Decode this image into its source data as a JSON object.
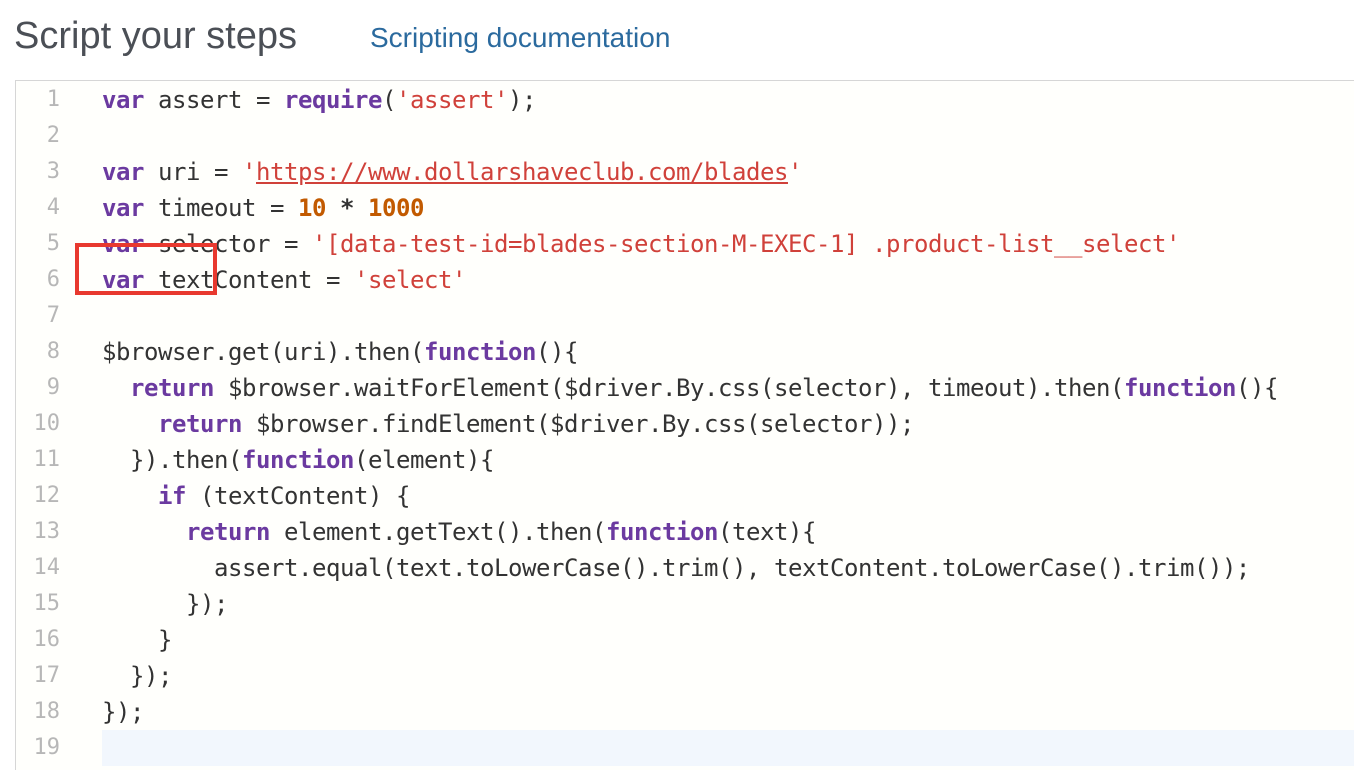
{
  "header": {
    "title": "Script your steps",
    "doc_link": "Scripting documentation"
  },
  "colors": {
    "keyword": "#6b3aa0",
    "string": "#d0413a",
    "number": "#c25a00",
    "link": "#2b6a9e",
    "highlight_box": "#e8392f",
    "gutter_text": "#b7b7b7"
  },
  "editor": {
    "line_numbers": [
      "1",
      "2",
      "3",
      "4",
      "5",
      "6",
      "7",
      "8",
      "9",
      "10",
      "11",
      "12",
      "13",
      "14",
      "15",
      "16",
      "17",
      "18",
      "19"
    ],
    "lines": [
      [
        {
          "t": "kw",
          "v": "var"
        },
        {
          "t": "p",
          "v": " assert = "
        },
        {
          "t": "kw",
          "v": "require"
        },
        {
          "t": "p",
          "v": "("
        },
        {
          "t": "str",
          "v": "'assert'"
        },
        {
          "t": "p",
          "v": ");"
        }
      ],
      [],
      [
        {
          "t": "kw",
          "v": "var"
        },
        {
          "t": "p",
          "v": " uri = "
        },
        {
          "t": "str",
          "v": "'"
        },
        {
          "t": "url",
          "v": "https://www.dollarshaveclub.com/blades"
        },
        {
          "t": "str",
          "v": "'"
        }
      ],
      [
        {
          "t": "kw",
          "v": "var"
        },
        {
          "t": "p",
          "v": " timeout = "
        },
        {
          "t": "num",
          "v": "10"
        },
        {
          "t": "p",
          "v": " "
        },
        {
          "t": "op",
          "v": "*"
        },
        {
          "t": "p",
          "v": " "
        },
        {
          "t": "num",
          "v": "1000"
        }
      ],
      [
        {
          "t": "kw",
          "v": "var"
        },
        {
          "t": "p",
          "v": " selector = "
        },
        {
          "t": "str",
          "v": "'[data-test-id=blades-section-M-EXEC-1] .product-list__select'"
        }
      ],
      [
        {
          "t": "kw",
          "v": "var"
        },
        {
          "t": "p",
          "v": " textContent = "
        },
        {
          "t": "str",
          "v": "'select'"
        }
      ],
      [],
      [
        {
          "t": "p",
          "v": "$browser.get(uri).then("
        },
        {
          "t": "kw",
          "v": "function"
        },
        {
          "t": "p",
          "v": "(){"
        }
      ],
      [
        {
          "t": "p",
          "v": "  "
        },
        {
          "t": "kw",
          "v": "return"
        },
        {
          "t": "p",
          "v": " $browser.waitForElement($driver.By.css(selector), timeout).then("
        },
        {
          "t": "kw",
          "v": "function"
        },
        {
          "t": "p",
          "v": "(){"
        }
      ],
      [
        {
          "t": "p",
          "v": "    "
        },
        {
          "t": "kw",
          "v": "return"
        },
        {
          "t": "p",
          "v": " $browser.findElement($driver.By.css(selector));"
        }
      ],
      [
        {
          "t": "p",
          "v": "  }).then("
        },
        {
          "t": "kw",
          "v": "function"
        },
        {
          "t": "p",
          "v": "(element){"
        }
      ],
      [
        {
          "t": "p",
          "v": "    "
        },
        {
          "t": "kw",
          "v": "if"
        },
        {
          "t": "p",
          "v": " (textContent) {"
        }
      ],
      [
        {
          "t": "p",
          "v": "      "
        },
        {
          "t": "kw",
          "v": "return"
        },
        {
          "t": "p",
          "v": " element.getText().then("
        },
        {
          "t": "kw",
          "v": "function"
        },
        {
          "t": "p",
          "v": "(text){"
        }
      ],
      [
        {
          "t": "p",
          "v": "        assert.equal(text.toLowerCase().trim(), textContent.toLowerCase().trim());"
        }
      ],
      [
        {
          "t": "p",
          "v": "      });"
        }
      ],
      [
        {
          "t": "p",
          "v": "    }"
        }
      ],
      [
        {
          "t": "p",
          "v": "  });"
        }
      ],
      [
        {
          "t": "p",
          "v": "});"
        }
      ],
      []
    ]
  }
}
